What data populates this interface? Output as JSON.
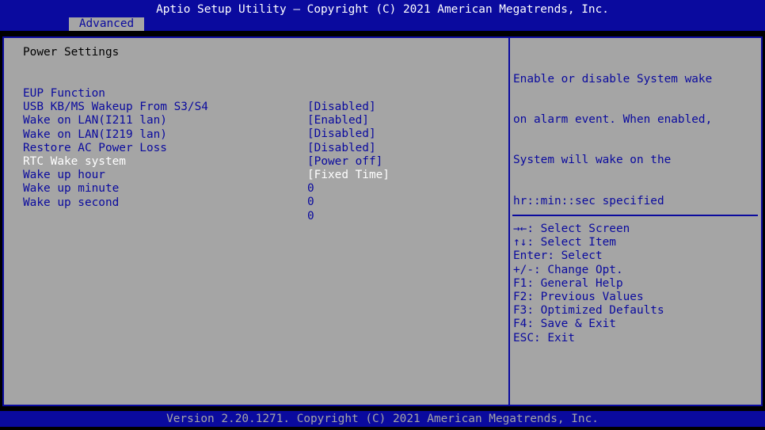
{
  "header": {
    "title": "Aptio Setup Utility – Copyright (C) 2021 American Megatrends, Inc.",
    "active_tab": "Advanced"
  },
  "main": {
    "section_title": "Power Settings",
    "settings": [
      {
        "label": "EUP Function",
        "value": "[Disabled]"
      },
      {
        "label": "USB KB/MS Wakeup From S3/S4",
        "value": "[Enabled]"
      },
      {
        "label": "Wake on LAN(I211 lan)",
        "value": "[Disabled]"
      },
      {
        "label": "Wake on LAN(I219 lan)",
        "value": "[Disabled]"
      },
      {
        "label": "Restore AC Power Loss",
        "value": "[Power off]"
      },
      {
        "label": "RTC Wake system",
        "value": "[Fixed Time]"
      },
      {
        "label": "Wake up hour",
        "value": "0"
      },
      {
        "label": "Wake up minute",
        "value": "0"
      },
      {
        "label": "Wake up second",
        "value": "0"
      }
    ],
    "selected_index": 5
  },
  "help": {
    "lines": [
      "Enable or disable System wake",
      "on alarm event. When enabled,",
      "System will wake on the",
      "hr::min::sec specified"
    ]
  },
  "keys": [
    "→←: Select Screen",
    "↑↓: Select Item",
    "Enter: Select",
    "+/-: Change Opt.",
    "F1: General Help",
    "F2: Previous Values",
    "F3: Optimized Defaults",
    "F4: Save & Exit",
    "ESC: Exit"
  ],
  "footer": {
    "text": "Version 2.20.1271. Copyright (C) 2021 American Megatrends, Inc."
  },
  "colors": {
    "bios_blue": "#0a0a9e",
    "panel_gray": "#a5a5a5",
    "highlight": "#ffffff"
  }
}
